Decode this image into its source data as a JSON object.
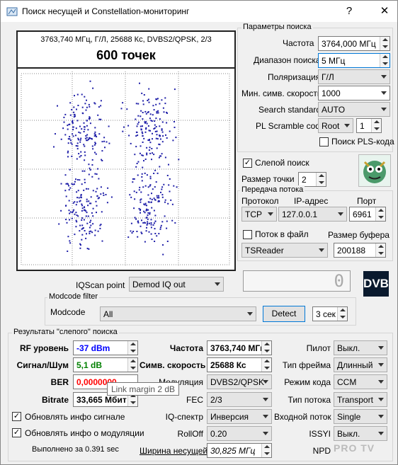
{
  "window": {
    "title": "Поиск несущей и Constellation-мониторинг",
    "help": "?",
    "minimize": "—",
    "close": "✕"
  },
  "plot": {
    "info": "3763,740 МГц, Г/Л, 25688 Кс, DVBS2/QPSK, 2/3",
    "points_label": "600 точек"
  },
  "params": {
    "title": "Параметры поиска",
    "freq_label": "Частота",
    "freq_value": "3764,000 МГц",
    "range_label": "Диапазон поиска",
    "range_value": "5 МГц",
    "pol_label": "Поляризация",
    "pol_value": "Г/Л",
    "minsym_label": "Мин. симв. скорость",
    "minsym_value": "1000",
    "std_label": "Search standard",
    "std_value": "AUTO",
    "pls_label": "PL Scramble code",
    "pls_mode": "Root",
    "pls_value": "1",
    "pls_search_label": "Поиск PLS-кода",
    "blind_label": "Слепой поиск",
    "dot_size_label": "Размер точки",
    "dot_size_value": "2"
  },
  "stream": {
    "title": "Передача потока",
    "proto_label": "Протокол",
    "ip_label": "IP-адрес",
    "port_label": "Порт",
    "proto_value": "TCP",
    "ip_value": "127.0.0.1",
    "port_value": "6961",
    "to_file_label": "Поток в файл",
    "buffer_label": "Размер буфера",
    "reader_value": "TSReader",
    "buffer_value": "200188"
  },
  "iq": {
    "label": "IQScan point",
    "value": "Demod IQ out",
    "counter": "0"
  },
  "modcode": {
    "title": "Modcode filter",
    "label": "Modcode",
    "value": "All",
    "detect": "Detect",
    "interval": "3 сек"
  },
  "results": {
    "title": "Результаты \"слепого\" поиска",
    "rf_label": "RF уровень",
    "rf_value": "-37 dBm",
    "snr_label": "Сигнал/Шум",
    "snr_value": "5,1 dB",
    "ber_label": "BER",
    "ber_value": "0,0000000",
    "bitrate_label": "Bitrate",
    "bitrate_value": "33,665 Мбит",
    "freq_label": "Частота",
    "freq_value": "3763,740 МГц",
    "sym_label": "Симв. скорость",
    "sym_value": "25688 Кс",
    "mod_label": "Модуляция",
    "mod_value": "DVBS2/QPSK",
    "fec_label": "FEC",
    "fec_value": "2/3",
    "iqspec_label": "IQ-спектр",
    "iqspec_value": "Инверсия",
    "rolloff_label": "RollOff",
    "rolloff_value": "0.20",
    "bw_label": "Ширина несущей",
    "bw_value": "30,825 МГц",
    "pilot_label": "Пилот",
    "pilot_value": "Выкл.",
    "frame_label": "Тип фрейма",
    "frame_value": "Длинный",
    "mode_label": "Режим кода",
    "mode_value": "CCM",
    "stype_label": "Тип потока",
    "stype_value": "Transport",
    "instream_label": "Входной поток",
    "instream_value": "Single",
    "issyi_label": "ISSYI",
    "issyi_value": "Выкл.",
    "npd_label": "NPD",
    "upd_signal_label": "Обновлять инфо сигнале",
    "upd_mod_label": "Обновлять инфо о модуляции",
    "elapsed": "Выполнено за 0.391 sec"
  },
  "tooltip": "Link margin 2 dB",
  "logo": {
    "dvb": "DVB",
    "watermark": "PRO TV"
  },
  "colors": {
    "rf": "#0000ff",
    "snr": "#008000",
    "ber": "#ff0000",
    "dots": "#1e1ea8"
  }
}
